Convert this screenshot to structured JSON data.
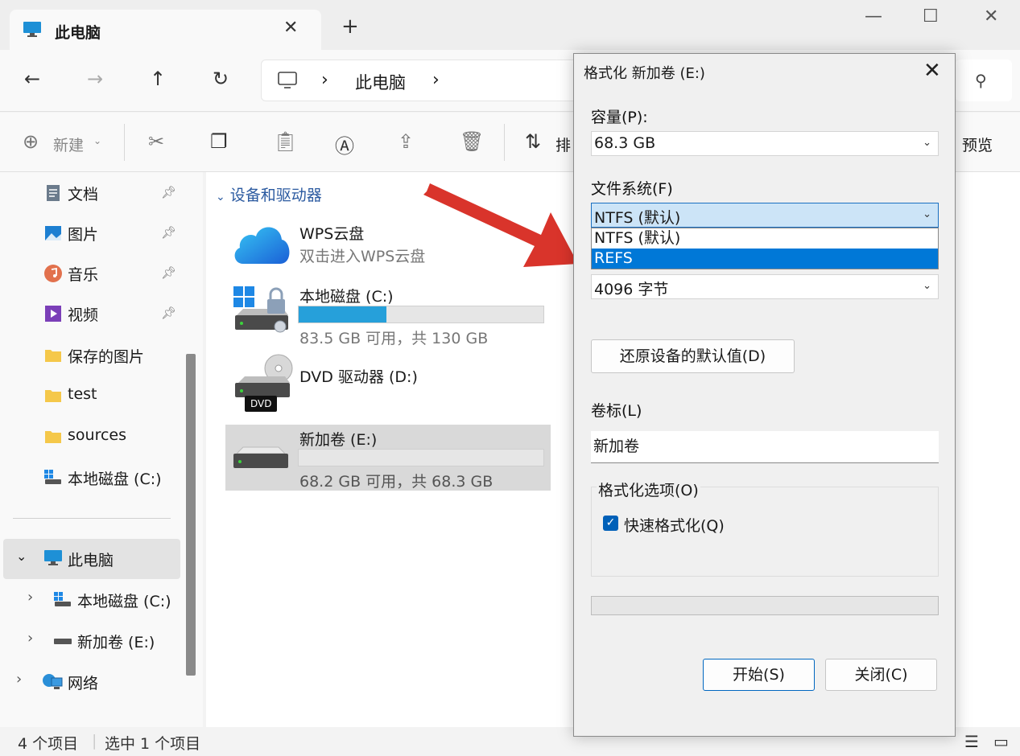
{
  "window": {
    "tab_title": "此电脑",
    "tab_close_glyph": "✕",
    "new_tab_glyph": "+",
    "minimize_glyph": "—",
    "maximize_glyph": "☐",
    "close_glyph": "✕"
  },
  "nav": {
    "back": "←",
    "forward": "→",
    "up": "↑",
    "refresh": "↻",
    "breadcrumb_sep": "›",
    "breadcrumb": "此电脑"
  },
  "toolbar": {
    "new_label": "新建",
    "sort_label": "排",
    "preview_label": "预览"
  },
  "sidebar": {
    "items": [
      {
        "label": "文档",
        "pinned": true
      },
      {
        "label": "图片",
        "pinned": true
      },
      {
        "label": "音乐",
        "pinned": true
      },
      {
        "label": "视频",
        "pinned": true
      },
      {
        "label": "保存的图片"
      },
      {
        "label": "test"
      },
      {
        "label": "sources"
      },
      {
        "label": "本地磁盘 (C:)"
      }
    ],
    "tree": [
      {
        "label": "此电脑",
        "expanded": true
      },
      {
        "label": "本地磁盘 (C:)"
      },
      {
        "label": "新加卷 (E:)"
      },
      {
        "label": "网络"
      }
    ]
  },
  "content": {
    "group_header": "设备和驱动器",
    "drives": [
      {
        "name": "WPS云盘",
        "sub": "双击进入WPS云盘"
      },
      {
        "name": "本地磁盘 (C:)",
        "sub": "83.5 GB 可用，共 130 GB",
        "used_fraction": 0.36
      },
      {
        "name": "DVD 驱动器 (D:)",
        "badge": "DVD"
      },
      {
        "name": "新加卷 (E:)",
        "sub": "68.2 GB 可用，共 68.3 GB",
        "used_fraction": 0.0
      }
    ]
  },
  "statusbar": {
    "count": "4 个项目",
    "selected": "选中 1 个项目"
  },
  "dialog": {
    "title": "格式化 新加卷 (E:)",
    "capacity_label": "容量(P):",
    "capacity_value": "68.3 GB",
    "fs_label": "文件系统(F)",
    "fs_value": "NTFS (默认)",
    "fs_options": [
      "NTFS (默认)",
      "REFS"
    ],
    "fs_highlighted": "REFS",
    "alloc_value": "4096 字节",
    "restore_button": "还原设备的默认值(D)",
    "volume_label": "卷标(L)",
    "volume_value": "新加卷",
    "options_legend": "格式化选项(O)",
    "quick_format": "快速格式化(Q)",
    "quick_format_checked": true,
    "progress": 0,
    "start_button": "开始(S)",
    "close_button": "关闭(C)"
  },
  "colors": {
    "accent": "#0078d7",
    "arrow": "#d9342b",
    "drive_bar": "#26a0da"
  }
}
